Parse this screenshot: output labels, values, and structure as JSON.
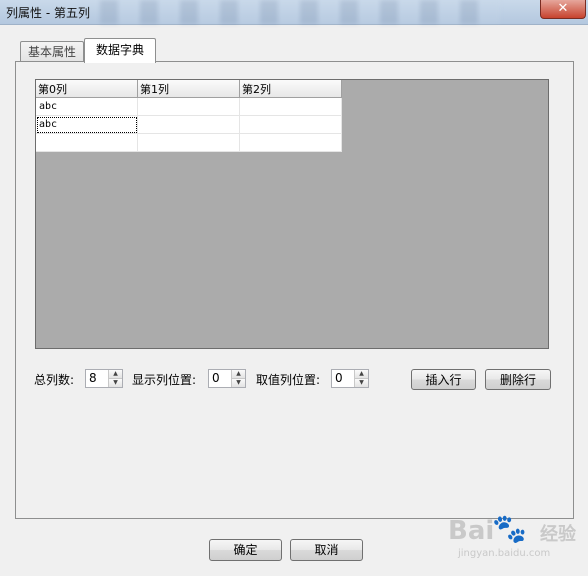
{
  "window": {
    "title": "列属性 - 第五列",
    "close_glyph": "✕"
  },
  "tabs": [
    {
      "label": "基本属性",
      "active": false
    },
    {
      "label": "数据字典",
      "active": true
    }
  ],
  "grid": {
    "columns": [
      "第0列",
      "第1列",
      "第2列"
    ],
    "rows": [
      [
        "abc",
        "",
        ""
      ],
      [
        "abc",
        "",
        ""
      ],
      [
        "",
        "",
        ""
      ]
    ]
  },
  "controls": {
    "total_columns_label": "总列数:",
    "total_columns_value": "8",
    "display_col_label": "显示列位置:",
    "display_col_value": "0",
    "value_col_label": "取值列位置:",
    "value_col_value": "0",
    "insert_row": "插入行",
    "delete_row": "删除行"
  },
  "footer": {
    "ok": "确定",
    "cancel": "取消"
  },
  "watermark": {
    "text": "Bai",
    "mark": "🐾",
    "suffix": "经验",
    "url": "jingyan.baidu.com"
  }
}
